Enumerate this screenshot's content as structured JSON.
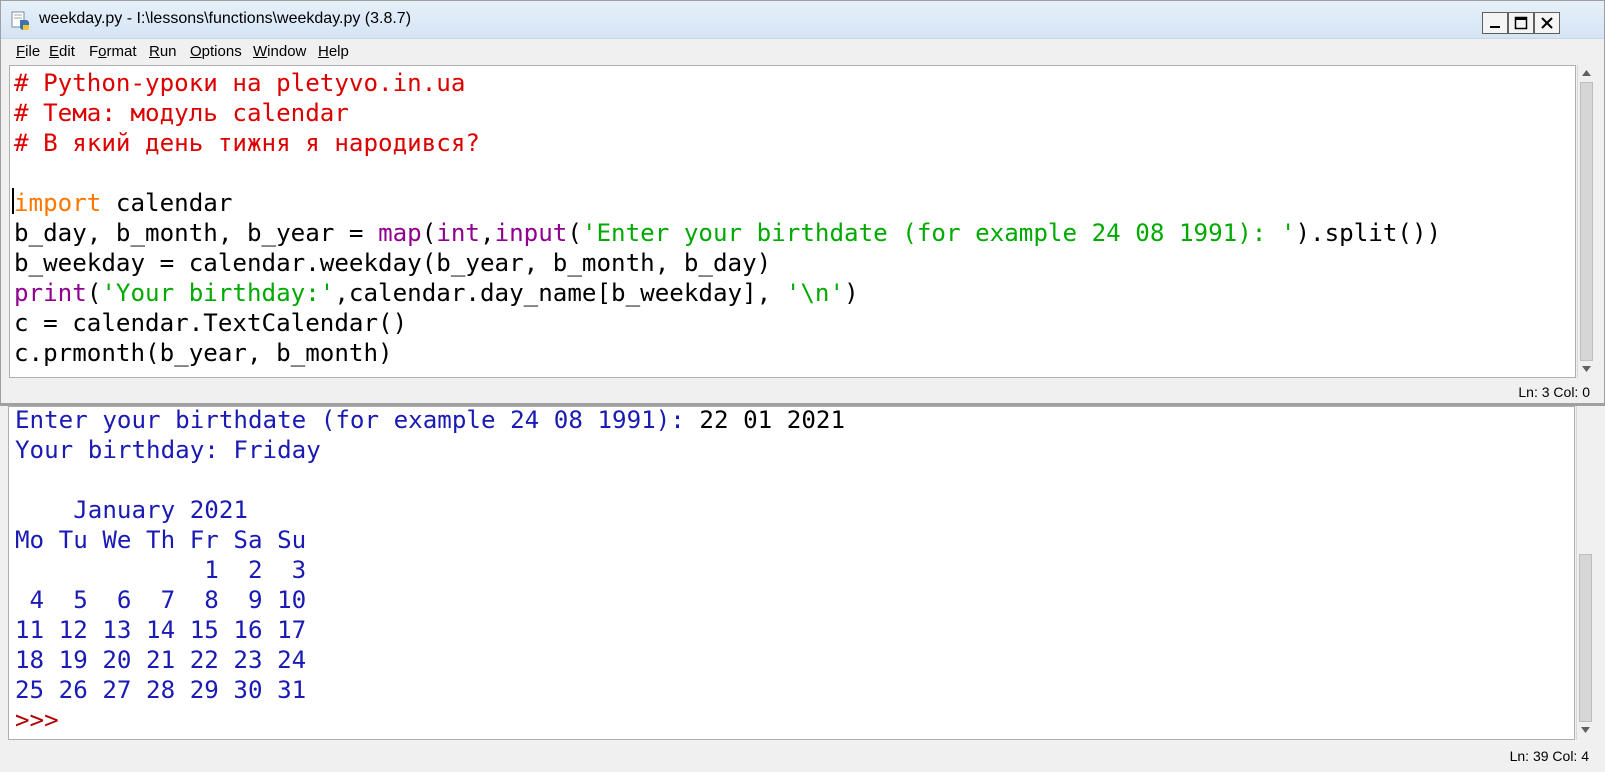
{
  "editor": {
    "title": "weekday.py - I:\\lessons\\functions\\weekday.py (3.8.7)",
    "menu": [
      "File",
      "Edit",
      "Format",
      "Run",
      "Options",
      "Window",
      "Help"
    ],
    "menu_mnemonic": [
      "F",
      "E",
      "o",
      "R",
      "O",
      "W",
      "H"
    ],
    "lines": [
      [
        {
          "t": "comment",
          "v": "# Python-уроки на pletyvo.in.ua"
        }
      ],
      [
        {
          "t": "comment",
          "v": "# Тема: модуль calendar"
        }
      ],
      [
        {
          "t": "comment",
          "v": "# В який день тижня я народився?"
        }
      ],
      [
        {
          "t": "plain",
          "v": ""
        }
      ],
      [
        {
          "t": "keyword",
          "v": "import"
        },
        {
          "t": "plain",
          "v": " calendar"
        }
      ],
      [
        {
          "t": "plain",
          "v": "b_day, b_month, b_year = "
        },
        {
          "t": "builtin",
          "v": "map"
        },
        {
          "t": "plain",
          "v": "("
        },
        {
          "t": "builtin",
          "v": "int"
        },
        {
          "t": "plain",
          "v": ","
        },
        {
          "t": "builtin",
          "v": "input"
        },
        {
          "t": "plain",
          "v": "("
        },
        {
          "t": "string",
          "v": "'Enter your birthdate (for example 24 08 1991): '"
        },
        {
          "t": "plain",
          "v": ").split())"
        }
      ],
      [
        {
          "t": "plain",
          "v": "b_weekday = calendar.weekday(b_year, b_month, b_day)"
        }
      ],
      [
        {
          "t": "builtin",
          "v": "print"
        },
        {
          "t": "plain",
          "v": "("
        },
        {
          "t": "string",
          "v": "'Your birthday:'"
        },
        {
          "t": "plain",
          "v": ",calendar.day_name[b_weekday], "
        },
        {
          "t": "string",
          "v": "'\\n'"
        },
        {
          "t": "plain",
          "v": ")"
        }
      ],
      [
        {
          "t": "plain",
          "v": "c = calendar.TextCalendar()"
        }
      ],
      [
        {
          "t": "plain",
          "v": "c.prmonth(b_year, b_month)"
        }
      ]
    ],
    "status": "Ln: 3   Col: 0"
  },
  "shell": {
    "lines": [
      [
        {
          "t": "out",
          "v": "Enter your birthdate (for example 24 08 1991): "
        },
        {
          "t": "in",
          "v": "22 01 2021"
        }
      ],
      [
        {
          "t": "out",
          "v": "Your birthday: Friday"
        }
      ],
      [
        {
          "t": "out",
          "v": ""
        }
      ],
      [
        {
          "t": "out",
          "v": "    January 2021"
        }
      ],
      [
        {
          "t": "out",
          "v": "Mo Tu We Th Fr Sa Su"
        }
      ],
      [
        {
          "t": "out",
          "v": "             1  2  3"
        }
      ],
      [
        {
          "t": "out",
          "v": " 4  5  6  7  8  9 10"
        }
      ],
      [
        {
          "t": "out",
          "v": "11 12 13 14 15 16 17"
        }
      ],
      [
        {
          "t": "out",
          "v": "18 19 20 21 22 23 24"
        }
      ],
      [
        {
          "t": "out",
          "v": "25 26 27 28 29 30 31"
        }
      ],
      [
        {
          "t": "prompt",
          "v": ">>>"
        }
      ]
    ],
    "status": "Ln: 39   Col: 4"
  },
  "colors": {
    "comment": "#dd0000",
    "keyword": "#ff7700",
    "builtin": "#900090",
    "string": "#00aa00",
    "shell_output": "#1a1ab4",
    "shell_prompt": "#b40000"
  },
  "icons": {
    "app": "python-idle-icon",
    "minimize": "minimize-icon",
    "maximize": "maximize-icon",
    "close": "close-icon"
  }
}
